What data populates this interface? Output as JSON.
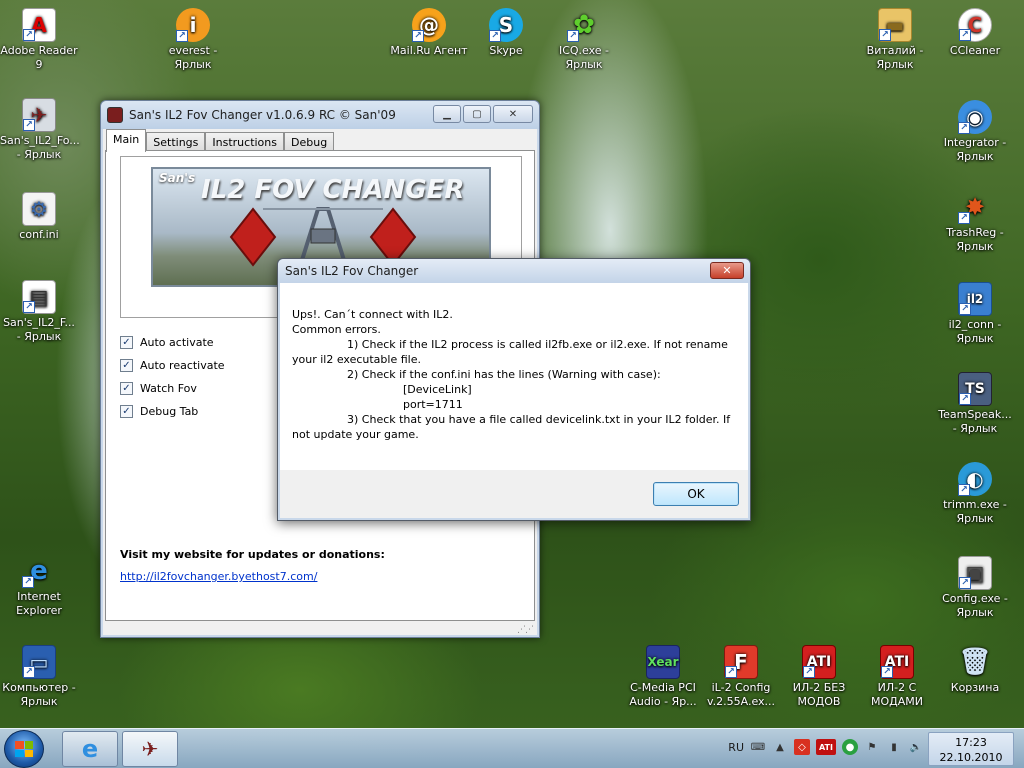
{
  "desktop": {
    "icons": [
      {
        "label": "Adobe Reader 9",
        "icon": "adobe-reader-icon"
      },
      {
        "label": "everest - Ярлык",
        "icon": "everest-icon"
      },
      {
        "label": "Mail.Ru Агент",
        "icon": "mailru-agent-icon"
      },
      {
        "label": "Skype",
        "icon": "skype-icon"
      },
      {
        "label": "ICQ.exe - Ярлык",
        "icon": "icq-icon"
      },
      {
        "label": "Виталий - Ярлык",
        "icon": "folder-icon"
      },
      {
        "label": "CCleaner",
        "icon": "ccleaner-icon"
      },
      {
        "label": "San's_IL2_Fo... - Ярлык",
        "icon": "il2-fov-changer-icon"
      },
      {
        "label": "conf.ini",
        "icon": "config-file-icon"
      },
      {
        "label": "San's_IL2_F... - Ярлык",
        "icon": "il2-fov-shortcut-icon"
      },
      {
        "label": "Integrator - Ярлык",
        "icon": "integrator-icon"
      },
      {
        "label": "TrashReg - Ярлык",
        "icon": "trashreg-icon"
      },
      {
        "label": "il2_conn - Ярлык",
        "icon": "il2-conn-icon"
      },
      {
        "label": "TeamSpeak... - Ярлык",
        "icon": "teamspeak-icon"
      },
      {
        "label": "trimm.exe - Ярлык",
        "icon": "trimm-icon"
      },
      {
        "label": "Config.exe - Ярлык",
        "icon": "config-exe-icon"
      },
      {
        "label": "Internet Explorer",
        "icon": "internet-explorer-icon"
      },
      {
        "label": "Компьютер - Ярлык",
        "icon": "computer-icon"
      },
      {
        "label": "C-Media PCI Audio - Яр...",
        "icon": "cmedia-icon"
      },
      {
        "label": "iL-2 Config v.2.55A.ex...",
        "icon": "il2-config-icon"
      },
      {
        "label": "ИЛ-2 БЕЗ МОДОВ",
        "icon": "ati-il2-icon"
      },
      {
        "label": "ИЛ-2 С МОДАМИ",
        "icon": "ati-il2-mods-icon"
      },
      {
        "label": "Корзина",
        "icon": "recycle-bin-icon"
      }
    ]
  },
  "main_window": {
    "title": "San's IL2 Fov Changer v1.0.6.9 RC © San'09",
    "tabs": [
      "Main",
      "Settings",
      "Instructions",
      "Debug"
    ],
    "banner": {
      "brand": "San's",
      "headline": "IL2 FOV CHANGER"
    },
    "checkboxes": [
      {
        "label": "Auto activate",
        "checked": true
      },
      {
        "label": "Auto reactivate",
        "checked": true
      },
      {
        "label": "Watch Fov",
        "checked": true
      },
      {
        "label": "Debug Tab",
        "checked": true
      }
    ],
    "website_label": "Visit my website for updates or donations:",
    "website_link": "http://il2fovchanger.byethost7.com/"
  },
  "dialog": {
    "title": "San's IL2 Fov Changer",
    "lines": [
      "Ups!. Can´t connect with IL2.",
      "Common errors.",
      "1) Check if the IL2 process is called il2fb.exe or il2.exe. If not rename",
      "your il2 executable file.",
      "2) Check if the conf.ini has the lines (Warning with case):",
      "[DeviceLink]",
      "port=1711",
      "3) Check that you have a file called devicelink.txt in your IL2 folder. If",
      "not update your game."
    ],
    "ok_label": "OK"
  },
  "taskbar": {
    "language": "RU",
    "time": "17:23",
    "date": "22.10.2010",
    "tray_ati": "ATI"
  }
}
